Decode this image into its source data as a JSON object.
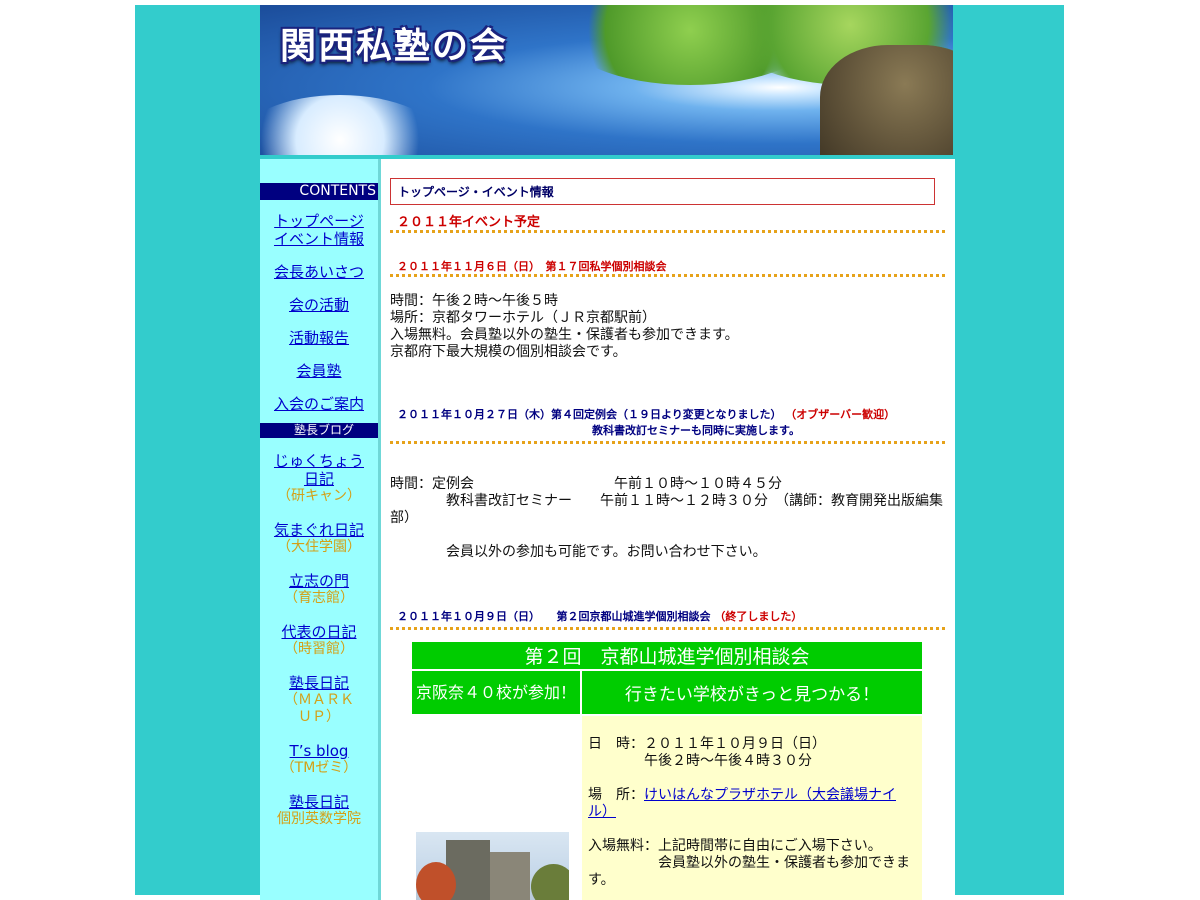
{
  "site": {
    "title": "関西私塾の会"
  },
  "sidebar": {
    "contents_label": "CONTENTS",
    "nav_items": [
      {
        "label": "トップページ\nイベント情報"
      },
      {
        "label": "会長あいさつ"
      },
      {
        "label": "会の活動"
      },
      {
        "label": "活動報告"
      },
      {
        "label": "会員塾"
      },
      {
        "label": "入会のご案内"
      }
    ],
    "blog_label": "塾長ブログ",
    "blogs": [
      {
        "title": "じゅくちょう日記",
        "owner": "（研キャン）"
      },
      {
        "title": "気まぐれ日記",
        "owner": "（大住学園）"
      },
      {
        "title": "立志の門",
        "owner": "（育志館）"
      },
      {
        "title": "代表の日記",
        "owner": "（時習館）"
      },
      {
        "title": "塾長日記",
        "owner": "（ＭＡＲＫ ＵＰ）"
      },
      {
        "title": "T’s blog",
        "owner": "（TMゼミ）"
      },
      {
        "title": "塾長日記",
        "owner": "個別英数学院"
      }
    ]
  },
  "main": {
    "breadcrumb": "トップページ・イベント情報",
    "year_heading": "２０１１年イベント予定",
    "event1": {
      "heading": "２０１１年１１月６日（日）　第１７回私学個別相談会",
      "lines": [
        "時間：午後２時〜午後５時",
        "場所：京都タワーホテル（ＪＲ京都駅前）",
        "入場無料。会員塾以外の塾生・保護者も参加できます。",
        "京都府下最大規模の個別相談会です。"
      ]
    },
    "event2": {
      "heading": "２０１１年１０月２７日（木）第４回定例会（１９日より変更となりました）",
      "heading_note": "（オブザーバー歓迎）",
      "subheading": "教科書改訂セミナーも同時に実施します。",
      "line1": "時間：定例会　　　　　　　　　　午前１０時〜１０時４５分",
      "line2": "　　　　教科書改訂セミナー　　午前１１時〜１２時３０分　（講師：教育開発出版編集部）",
      "line3": "　　　　会員以外の参加も可能です。お問い合わせ下さい。"
    },
    "event3": {
      "heading": "２０１１年１０月９日（日）　　第２回京都山城進学個別相談会",
      "heading_note": "（終了しました）",
      "banner_title": "第２回　京都山城進学個別相談会",
      "banner_left": "京阪奈４０校が参加！",
      "banner_right": "行きたい学校がきっと見つかる！",
      "date_line1": "日　時：２０１１年１０月９日（日）",
      "date_line2": "　　　　午後２時〜午後４時３０分",
      "place_label": "場　所：",
      "place_link": "けいはんなプラザホテル（大会議場ナイル）",
      "admission": "入場無料：上記時間帯に自由にご入場下さい。",
      "note": "　　　　　会員塾以外の塾生・保護者も参加できます。"
    }
  }
}
